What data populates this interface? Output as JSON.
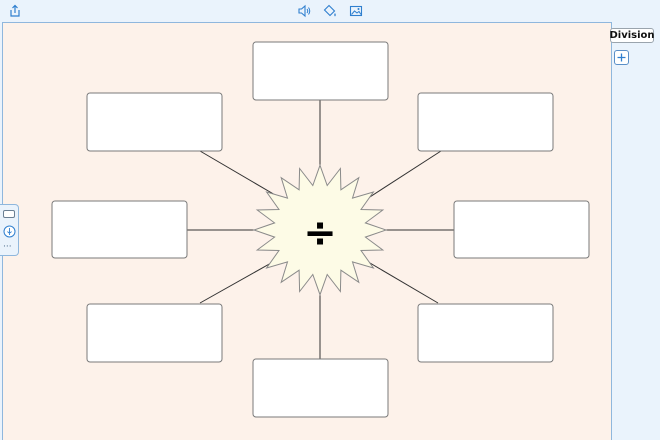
{
  "toolbar": {
    "share_icon": "share-icon",
    "audio_icon": "speaker-icon",
    "fill_icon": "paint-fill-icon",
    "image_icon": "image-icon"
  },
  "canvas": {
    "center_symbol": "÷",
    "center_fill": "#fdfbe6",
    "boxes": [
      "",
      "",
      "",
      "",
      "",
      "",
      "",
      ""
    ]
  },
  "side_panel": {
    "tab_label": "Division",
    "add_label": "+"
  },
  "left_strip": {
    "more_label": "···"
  },
  "colors": {
    "app_background": "#eaf3fc",
    "canvas_background": "#fdf2ea",
    "accent": "#2f7fcf"
  }
}
